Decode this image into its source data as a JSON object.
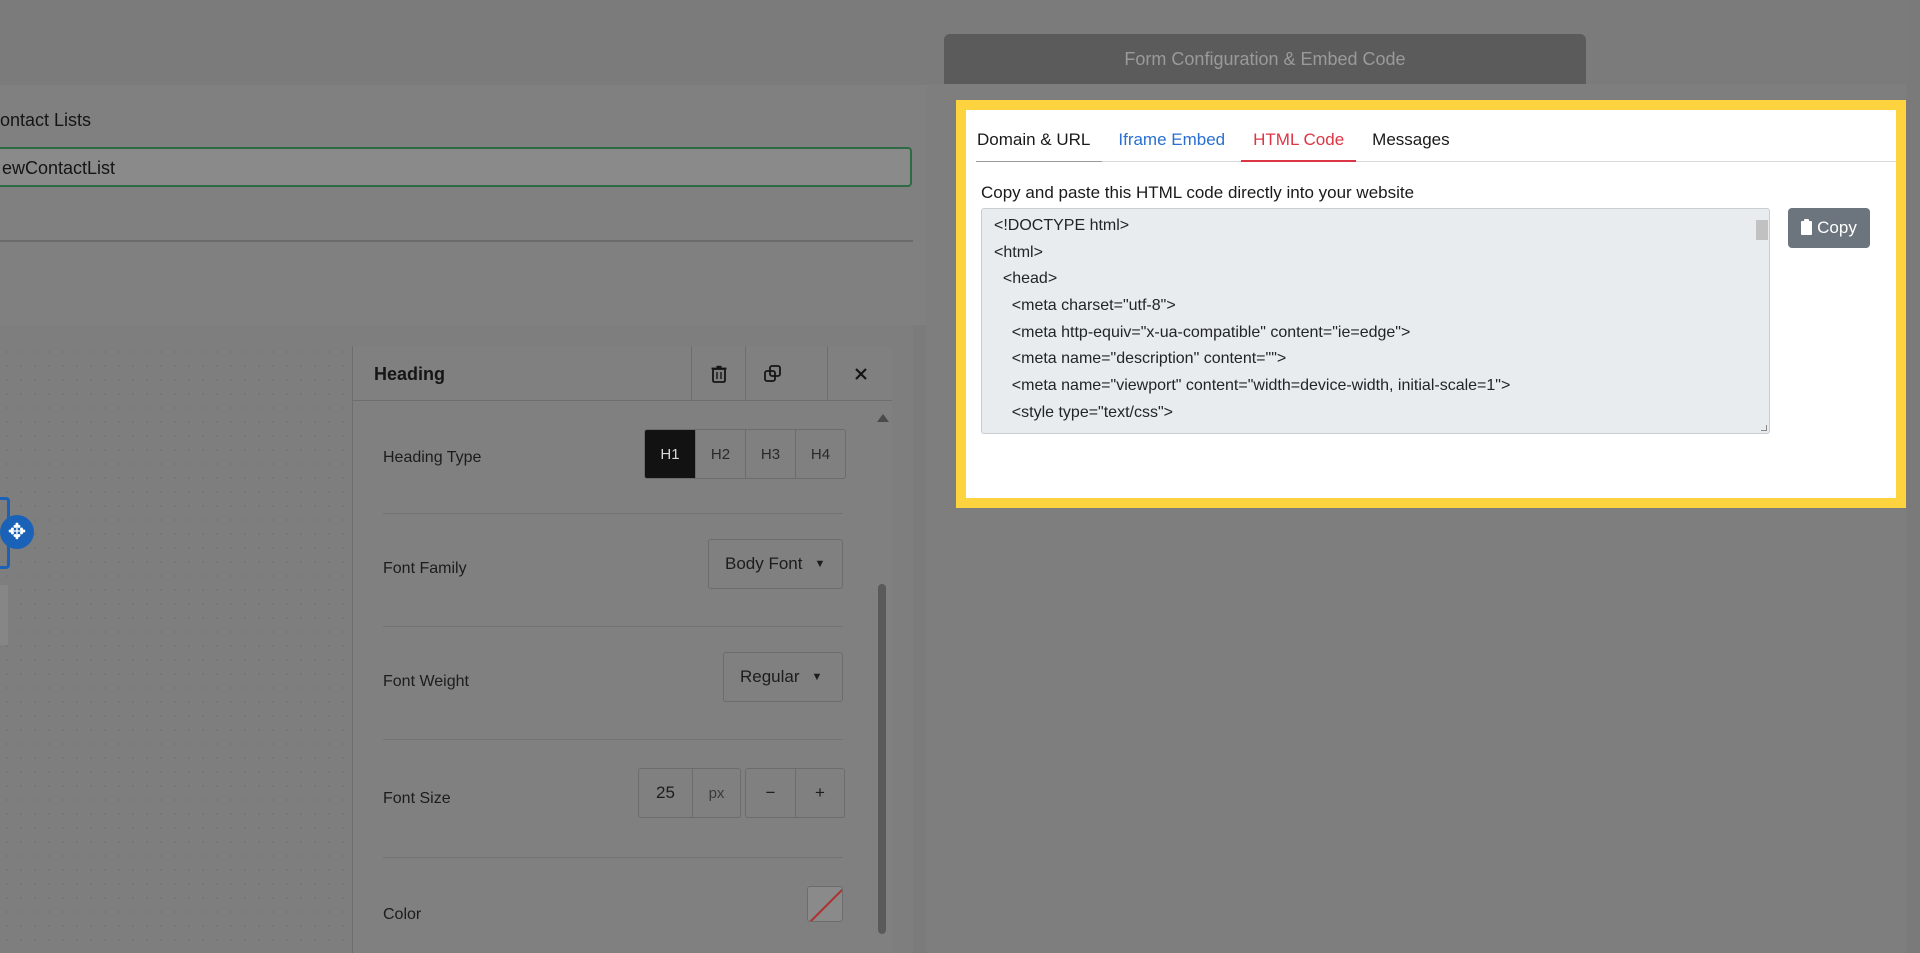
{
  "form": {
    "contact_lists_label": "ontact Lists",
    "contact_list_value": "ewContactList"
  },
  "settings": {
    "title": "Heading",
    "heading_type": {
      "label": "Heading Type",
      "options": [
        "H1",
        "H2",
        "H3",
        "H4"
      ],
      "selected": "H1"
    },
    "font_family": {
      "label": "Font Family",
      "value": "Body Font"
    },
    "font_weight": {
      "label": "Font Weight",
      "value": "Regular"
    },
    "font_size": {
      "label": "Font Size",
      "value": "25",
      "unit": "px",
      "minus": "−",
      "plus": "+"
    },
    "color": {
      "label": "Color"
    },
    "icons": {
      "delete": "trash-icon",
      "duplicate": "copy-icon",
      "close": "close-icon"
    }
  },
  "right_panel": {
    "header_title": "Form Configuration & Embed Code",
    "tabs": [
      {
        "label": "Domain & URL"
      },
      {
        "label": "Iframe Embed"
      },
      {
        "label": "HTML Code"
      },
      {
        "label": "Messages"
      }
    ],
    "active_tab": "HTML Code",
    "instruction": "Copy and paste this HTML code directly into your website",
    "code_lines": [
      "<!DOCTYPE html>",
      "<html>",
      "  <head>",
      "    <meta charset=\"utf-8\">",
      "    <meta http-equiv=\"x-ua-compatible\" content=\"ie=edge\">",
      "    <meta name=\"description\" content=\"\">",
      "    <meta name=\"viewport\" content=\"width=device-width, initial-scale=1\">",
      "    <style type=\"text/css\">"
    ],
    "copy_label": "Copy"
  },
  "colors": {
    "highlight": "#fdd33f",
    "active_tab": "#dc3545",
    "link_tab": "#2a6fd1",
    "copy_button": "#6c757d"
  }
}
